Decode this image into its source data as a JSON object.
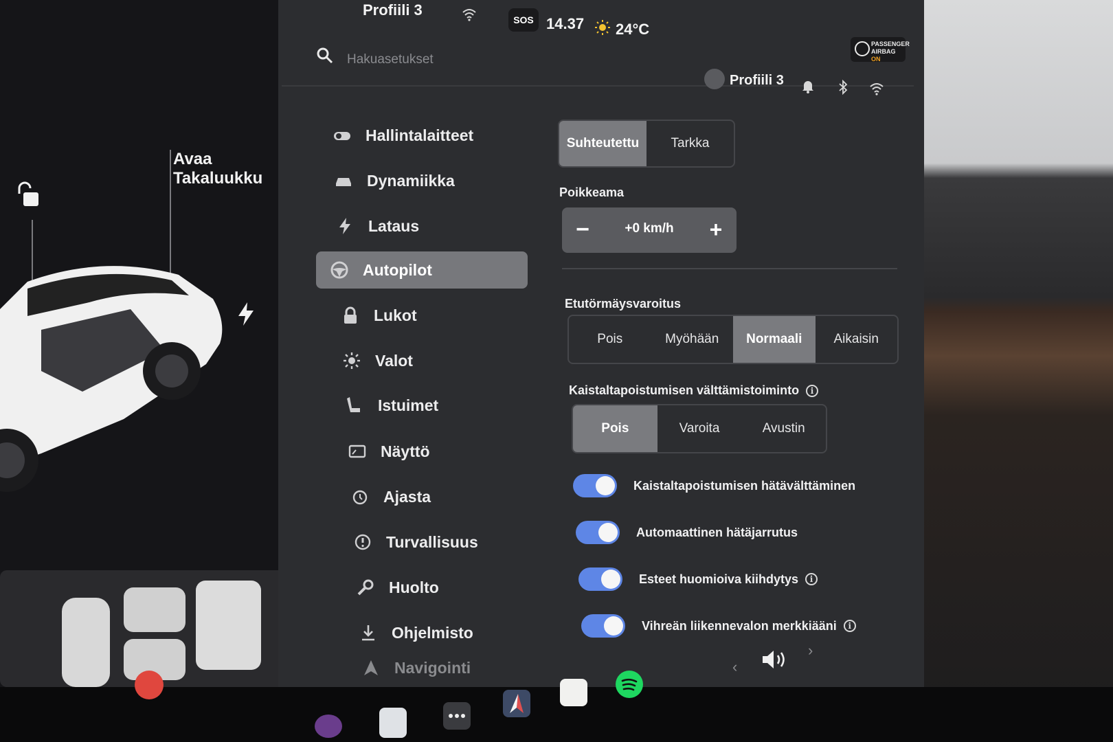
{
  "status_bar": {
    "profile_name": "Profiili 3",
    "sos_label": "SOS",
    "time": "14.37",
    "temperature": "24°C",
    "airbag_line1": "PASSENGER",
    "airbag_line2": "AIRBAG",
    "airbag_state": "ON"
  },
  "car_panel": {
    "trunk_line1": "Avaa",
    "trunk_line2": "Takaluukku"
  },
  "search": {
    "placeholder": "Hakuasetukset"
  },
  "header": {
    "profile_name": "Profiili 3"
  },
  "sidebar": {
    "items": [
      {
        "label": "Hallintalaitteet",
        "icon": "toggle-icon"
      },
      {
        "label": "Dynamiikka",
        "icon": "car-icon"
      },
      {
        "label": "Lataus",
        "icon": "bolt-icon"
      },
      {
        "label": "Autopilot",
        "icon": "steering-wheel-icon",
        "active": true
      },
      {
        "label": "Lukot",
        "icon": "lock-icon"
      },
      {
        "label": "Valot",
        "icon": "sun-icon"
      },
      {
        "label": "Istuimet",
        "icon": "seat-icon"
      },
      {
        "label": "Näyttö",
        "icon": "display-icon"
      },
      {
        "label": "Ajasta",
        "icon": "alarm-clock-icon"
      },
      {
        "label": "Turvallisuus",
        "icon": "alert-circle-icon"
      },
      {
        "label": "Huolto",
        "icon": "wrench-icon"
      },
      {
        "label": "Ohjelmisto",
        "icon": "download-icon"
      },
      {
        "label": "Navigointi",
        "icon": "navigation-icon"
      }
    ]
  },
  "speed_limit_mode": {
    "options": [
      "Suhteutettu",
      "Tarkka"
    ],
    "selected": "Suhteutettu"
  },
  "offset": {
    "label": "Poikkeama",
    "value": "+0 km/h",
    "minus": "−",
    "plus": "+"
  },
  "forward_collision": {
    "label": "Etutörmäysvaroitus",
    "options": [
      "Pois",
      "Myöhään",
      "Normaali",
      "Aikaisin"
    ],
    "selected": "Normaali"
  },
  "lane_departure": {
    "label": "Kaistaltapoistumisen välttämistoiminto",
    "info": "i",
    "options": [
      "Pois",
      "Varoita",
      "Avustin"
    ],
    "selected": "Pois"
  },
  "toggles": [
    {
      "label": "Kaistaltapoistumisen hätävälttäminen",
      "on": true,
      "info": false
    },
    {
      "label": "Automaattinen hätäjarrutus",
      "on": true,
      "info": false
    },
    {
      "label": "Esteet huomioiva kiihdytys",
      "on": true,
      "info": true
    },
    {
      "label": "Vihreän liikennevalon merkkiääni",
      "on": true,
      "info": true
    }
  ],
  "info_glyph": "i",
  "colors": {
    "toggle_on": "#5e86e6",
    "selected_segment": "#7a7b7f",
    "screen_bg": "#2c2d30",
    "seat_warning": "#e0473e"
  },
  "dock": {
    "icons": [
      "camera-icon",
      "info-card-icon",
      "more-icon",
      "navigation-app-icon",
      "notes-icon",
      "spotify-icon"
    ]
  }
}
